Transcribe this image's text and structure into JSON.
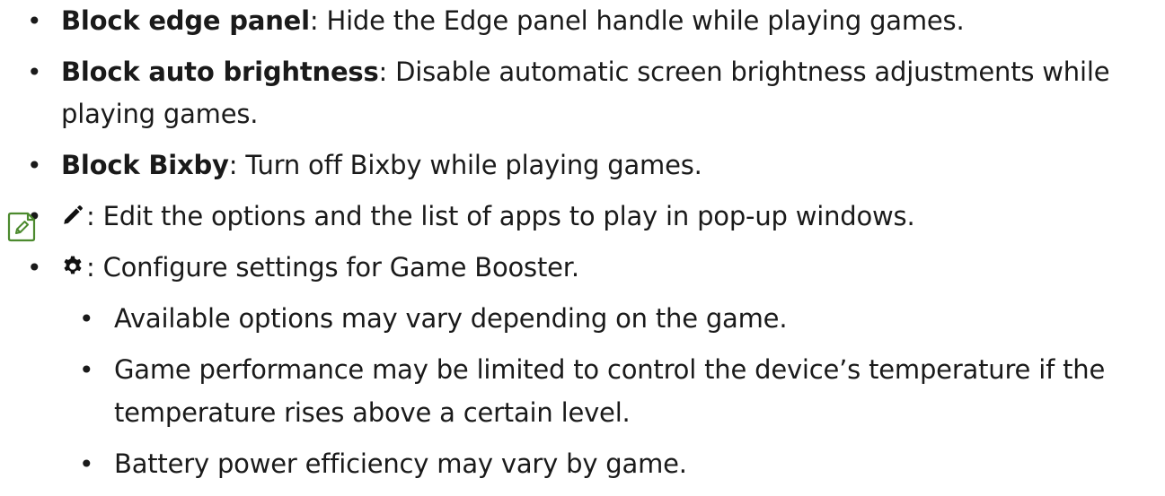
{
  "items": [
    {
      "term": "Block edge panel",
      "desc": ": Hide the Edge panel handle while playing games."
    },
    {
      "term": "Block auto brightness",
      "desc": ": Disable automatic screen brightness adjustments while",
      "desc2": "playing games."
    },
    {
      "term": "Block Bixby",
      "desc": ": Turn off Bixby while playing games."
    },
    {
      "icon": "pencil-icon",
      "desc": ": Edit the options and the list of apps to play in pop-up windows."
    },
    {
      "icon": "gear-icon",
      "desc": ": Configure settings for Game Booster."
    }
  ],
  "note": {
    "icon": "note-icon",
    "items": [
      {
        "text": "Available options may vary depending on the game."
      },
      {
        "text": "Game performance may be limited to control the device’s temperature if the",
        "text2": "temperature rises above a certain level."
      },
      {
        "text": "Battery power efficiency may vary by game."
      }
    ]
  },
  "colors": {
    "text": "#1a1a1a",
    "note_icon": "#4c8a2e"
  }
}
